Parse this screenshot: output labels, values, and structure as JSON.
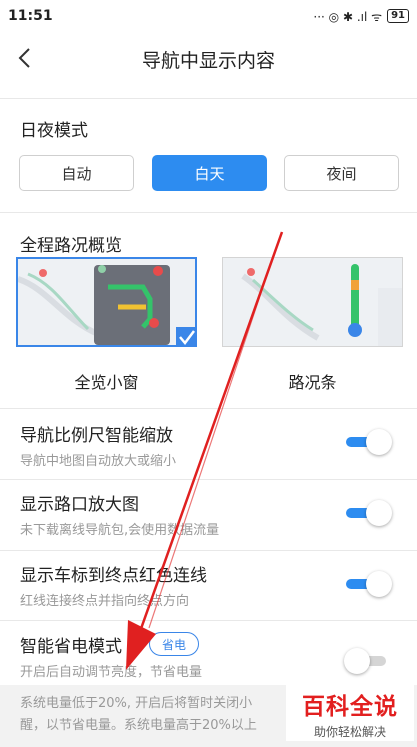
{
  "status_bar": {
    "time": "11:51",
    "indicators": "··· ◎ ✱ .ıl ᯤ",
    "battery": "91"
  },
  "header": {
    "title": "导航中显示内容",
    "back_icon": "chevron-left-icon"
  },
  "day_night": {
    "label": "日夜模式",
    "options": [
      "自动",
      "白天",
      "夜间"
    ],
    "selected": "白天"
  },
  "overview": {
    "label": "全程路况概览",
    "options": [
      {
        "caption": "全览小窗",
        "selected": true
      },
      {
        "caption": "路况条",
        "selected": false
      }
    ]
  },
  "settings": [
    {
      "title": "导航比例尺智能缩放",
      "subtitle": "导航中地图自动放大或缩小",
      "enabled": true
    },
    {
      "title": "显示路口放大图",
      "subtitle": "未下载离线导航包,会使用数据流量",
      "enabled": true
    },
    {
      "title": "显示车标到终点红色连线",
      "subtitle": "红线连接终点并指向终点方向",
      "enabled": true
    },
    {
      "title": "智能省电模式",
      "subtitle": "开启后自动调节亮度，节省电量",
      "badge": "省电",
      "enabled": false
    }
  ],
  "note": {
    "line1": "系统电量低于20%, 开启后将暂时关闭小",
    "line2": "醒，以节省电量。系统电量高于20%以上"
  },
  "watermark": {
    "main": "百科全说",
    "sub": "助你轻松解决"
  },
  "colors": {
    "accent": "#2d8cf0",
    "arrow": "#e02020",
    "watermark": "#e21f1f"
  }
}
